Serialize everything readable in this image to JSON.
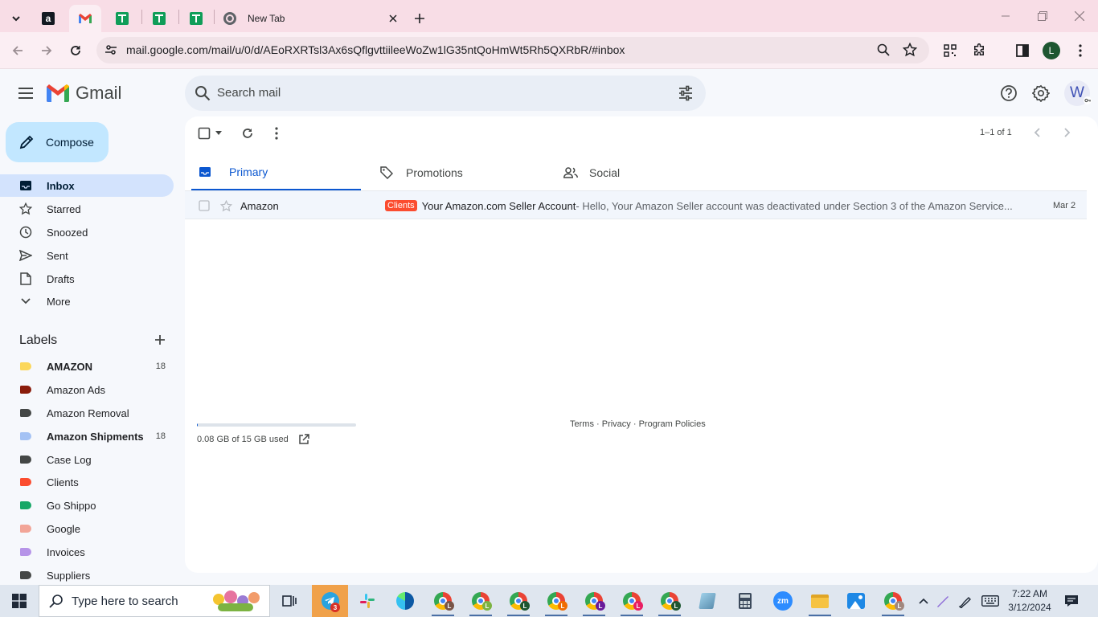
{
  "browser": {
    "tabs": [
      {
        "title": "",
        "icon": "amazon-icon"
      },
      {
        "title": "",
        "icon": "gmail-icon"
      },
      {
        "title": "",
        "icon": "sheets-icon"
      },
      {
        "title": "",
        "icon": "sheets-icon"
      },
      {
        "title": "",
        "icon": "sheets-icon"
      },
      {
        "title": "New Tab",
        "icon": "chrome-icon"
      }
    ],
    "url": "mail.google.com/mail/u/0/d/AEoRXRTsl3Ax6sQflgvttiileeWoZw1lG35ntQoHmWt5Rh5QXRbR/#inbox",
    "profile_initial": "L"
  },
  "gmail": {
    "logo_text": "Gmail",
    "search_placeholder": "Search mail",
    "account_initial": "W",
    "compose_label": "Compose",
    "nav": [
      {
        "label": "Inbox",
        "active": true
      },
      {
        "label": "Starred"
      },
      {
        "label": "Snoozed"
      },
      {
        "label": "Sent"
      },
      {
        "label": "Drafts"
      },
      {
        "label": "More"
      }
    ],
    "labels_heading": "Labels",
    "labels": [
      {
        "label": "AMAZON",
        "count": "18",
        "color": "#fbd75b",
        "bold": true
      },
      {
        "label": "Amazon Ads",
        "count": "",
        "color": "#8a1c0b"
      },
      {
        "label": "Amazon Removal",
        "count": "",
        "color": "#444746"
      },
      {
        "label": "Amazon Shipments",
        "count": "18",
        "color": "#a4c2f4",
        "bold": true
      },
      {
        "label": "Case Log",
        "count": "",
        "color": "#444746"
      },
      {
        "label": "Clients",
        "count": "",
        "color": "#fb4c2f"
      },
      {
        "label": "Go Shippo",
        "count": "",
        "color": "#16a766"
      },
      {
        "label": "Google",
        "count": "",
        "color": "#f2a598"
      },
      {
        "label": "Invoices",
        "count": "",
        "color": "#b694e8"
      },
      {
        "label": "Suppliers",
        "count": "",
        "color": "#444746"
      }
    ],
    "pagination": "1–1 of 1",
    "tabs": [
      {
        "label": "Primary",
        "active": true
      },
      {
        "label": "Promotions"
      },
      {
        "label": "Social"
      }
    ],
    "email": {
      "sender": "Amazon",
      "label_chip": "Clients",
      "subject": "Your Amazon.com Seller Account",
      "snippet": " - Hello, Your Amazon Seller account was deactivated under Section 3 of the Amazon Service...",
      "date": "Mar 2"
    },
    "storage": {
      "text": "0.08 GB of 15 GB used",
      "fraction": 0.005
    },
    "footer": {
      "terms": "Terms",
      "privacy": "Privacy",
      "policies": "Program Policies",
      "sep": " · "
    }
  },
  "taskbar": {
    "search_placeholder": "Type here to search",
    "time": "7:22 AM",
    "date": "3/12/2024",
    "telegram_badge": "3"
  },
  "colors": {
    "accent": "#0b57d0",
    "compose_bg": "#c2e7ff",
    "nav_active": "#d3e3fd",
    "tabstrip": "#f8dde6",
    "clients_chip": "#fb4c2f"
  }
}
